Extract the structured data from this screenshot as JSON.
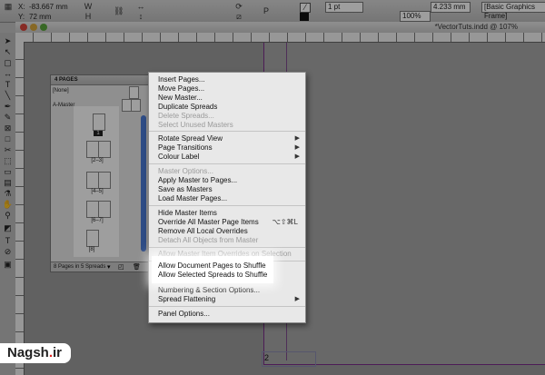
{
  "control_bar": {
    "x_value": "-83.667 mm",
    "y_value": "72 mm",
    "stroke_weight": "1 pt",
    "percent": "100%",
    "size_value": "4.233 mm",
    "frame_style": "[Basic Graphics Frame]"
  },
  "document": {
    "title": "*VectorTuts.indd @ 107%",
    "page_number": "2"
  },
  "pages_panel": {
    "tab_label": "4 PAGES",
    "none_label": "[None]",
    "master_label": "A-Master",
    "spreads": [
      {
        "caption": "1"
      },
      {
        "caption": "[2–3]"
      },
      {
        "caption": "[4–5]"
      },
      {
        "caption": "[6–7]"
      },
      {
        "caption": "[8]"
      }
    ],
    "footer_text": "8 Pages in 5 Spreads"
  },
  "context_menu": {
    "items": [
      {
        "label": "Insert Pages...",
        "enabled": true
      },
      {
        "label": "Move Pages...",
        "enabled": true
      },
      {
        "label": "New Master...",
        "enabled": true
      },
      {
        "label": "Duplicate Spreads",
        "enabled": true
      },
      {
        "label": "Delete Spreads...",
        "enabled": false
      },
      {
        "label": "Select Unused Masters",
        "enabled": false
      },
      {
        "label": "Rotate Spread View",
        "enabled": true,
        "submenu": true
      },
      {
        "label": "Page Transitions",
        "enabled": true,
        "submenu": true
      },
      {
        "label": "Colour Label",
        "enabled": true,
        "submenu": true
      },
      {
        "label": "Master Options...",
        "enabled": false
      },
      {
        "label": "Apply Master to Pages...",
        "enabled": true
      },
      {
        "label": "Save as Masters",
        "enabled": true
      },
      {
        "label": "Load Master Pages...",
        "enabled": true
      },
      {
        "label": "Hide Master Items",
        "enabled": true
      },
      {
        "label": "Override All Master Page Items",
        "enabled": true,
        "shortcut": "⌥⇧⌘L"
      },
      {
        "label": "Remove All Local Overrides",
        "enabled": true
      },
      {
        "label": "Detach All Objects from Master",
        "enabled": false
      },
      {
        "label": "Allow Master Item Overrides on Selection",
        "enabled": false
      },
      {
        "label": "Allow Document Pages to Shuffle",
        "enabled": true
      },
      {
        "label": "Allow Selected Spreads to Shuffle",
        "enabled": true
      },
      {
        "label": "Numbering & Section Options...",
        "enabled": true
      },
      {
        "label": "Spread Flattening",
        "enabled": true,
        "submenu": true
      },
      {
        "label": "Panel Options...",
        "enabled": true
      }
    ]
  },
  "watermark": {
    "text_main": "Nagsh",
    "text_dot": ".",
    "text_tld": "ir"
  },
  "colors": {
    "menu_bg": "#e8e8e8",
    "highlight": "#ffffff",
    "scroll_blue": "#4a7ad6",
    "page_border": "#7a2d8a",
    "watermark_dot": "#e0221d"
  }
}
